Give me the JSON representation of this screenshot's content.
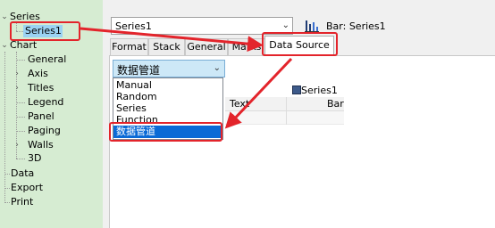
{
  "tree": {
    "series_label": "Series",
    "series1_label": "Series1",
    "chart_label": "Chart",
    "chart_children": [
      "General",
      "Axis",
      "Titles",
      "Legend",
      "Panel",
      "Paging",
      "Walls",
      "3D"
    ],
    "data_label": "Data",
    "export_label": "Export",
    "print_label": "Print"
  },
  "header": {
    "series_combo_value": "Series1",
    "bar_title": "Bar: Series1"
  },
  "tabs": [
    "Format",
    "Stack",
    "General",
    "Marks",
    "Data Source"
  ],
  "data_source": {
    "selected": "数据管道",
    "options": [
      "Manual",
      "Random",
      "Series",
      "Function",
      "数据管道"
    ]
  },
  "grid": {
    "series_name": "Series1",
    "col_text": "Text",
    "col_bar": "Bar"
  },
  "colors": {
    "highlight": "#e3242b",
    "tree_background": "#d6ecd2",
    "selected_option": "#0a6ad6"
  }
}
